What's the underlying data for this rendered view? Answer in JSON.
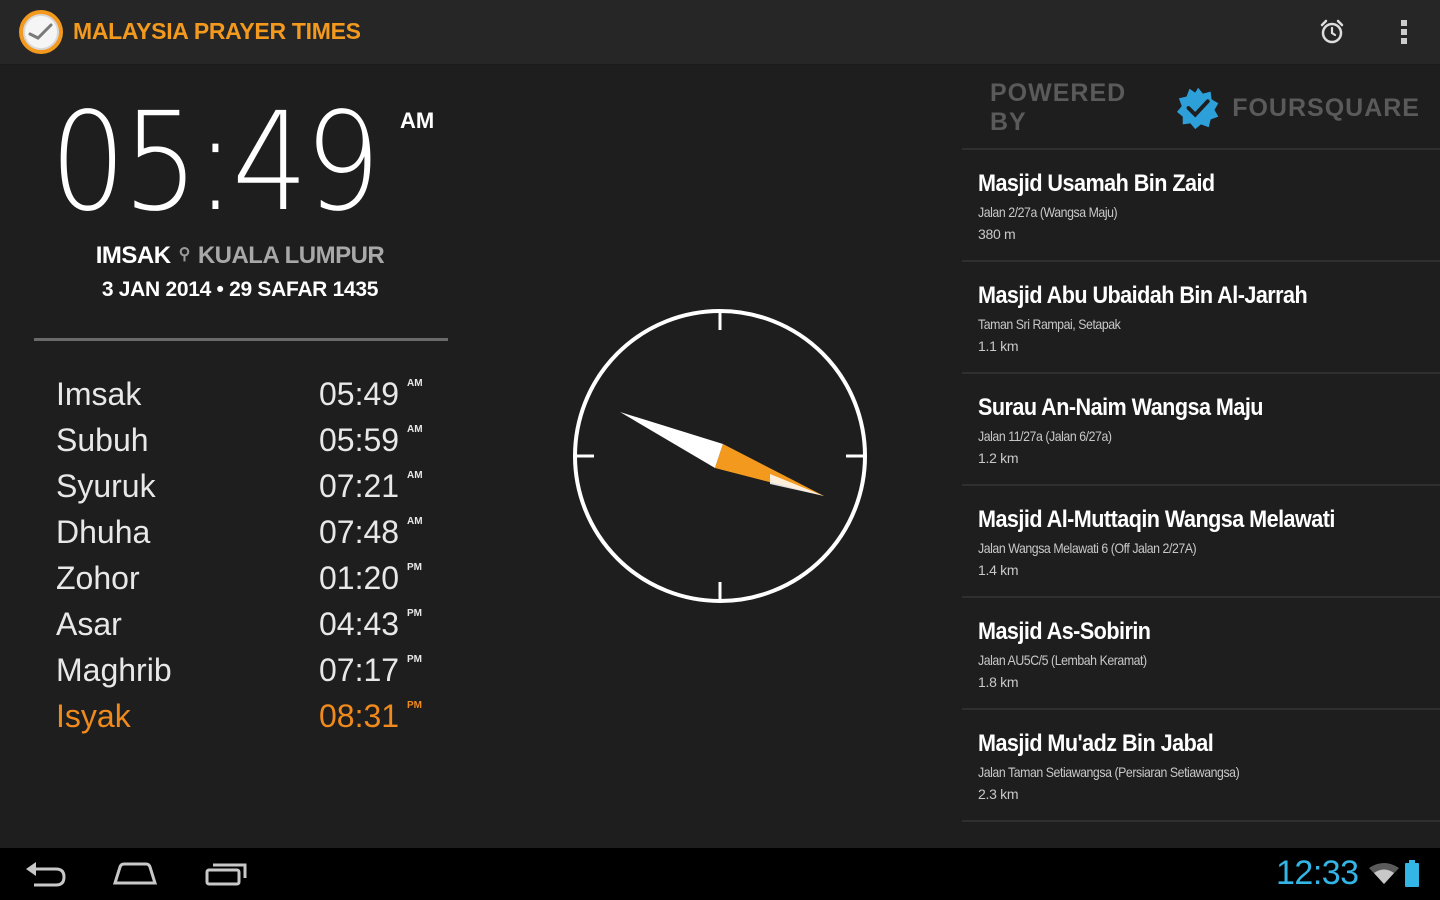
{
  "app": {
    "title": "MALAYSIA PRAYER TIMES",
    "accent_color": "#f39a1e",
    "actions": [
      "alarm-icon",
      "overflow-menu-icon"
    ]
  },
  "clock": {
    "time": "05:49",
    "ampm": "AM",
    "current_prayer": "IMSAK",
    "location": "KUALA LUMPUR",
    "date": "3 JAN 2014 • 29 SAFAR 1435"
  },
  "prayers": [
    {
      "name": "Imsak",
      "time": "05:49",
      "ampm": "AM"
    },
    {
      "name": "Subuh",
      "time": "05:59",
      "ampm": "AM"
    },
    {
      "name": "Syuruk",
      "time": "07:21",
      "ampm": "AM"
    },
    {
      "name": "Dhuha",
      "time": "07:48",
      "ampm": "AM"
    },
    {
      "name": "Zohor",
      "time": "01:20",
      "ampm": "PM"
    },
    {
      "name": "Asar",
      "time": "04:43",
      "ampm": "PM"
    },
    {
      "name": "Maghrib",
      "time": "07:17",
      "ampm": "PM"
    },
    {
      "name": "Isyak",
      "time": "08:31",
      "ampm": "PM"
    }
  ],
  "highlight_color": "#f08a1c",
  "compass": {
    "needle_colors": {
      "white": "#ffffff",
      "qibla": "#f39a1e"
    }
  },
  "powered_by": {
    "prefix": "POWERED BY",
    "brand": "FOURSQUARE",
    "brand_icon_color": "#2d9fd9"
  },
  "mosques": [
    {
      "name": "Masjid Usamah Bin Zaid",
      "address": "Jalan 2/27a (Wangsa Maju)",
      "distance": "380 m"
    },
    {
      "name": "Masjid Abu Ubaidah Bin Al-Jarrah",
      "address": "Taman Sri Rampai, Setapak",
      "distance": "1.1 km"
    },
    {
      "name": "Surau An-Naim Wangsa Maju",
      "address": "Jalan 11/27a (Jalan 6/27a)",
      "distance": "1.2 km"
    },
    {
      "name": "Masjid Al-Muttaqin Wangsa Melawati",
      "address": "Jalan Wangsa Melawati 6 (Off Jalan 2/27A)",
      "distance": "1.4 km"
    },
    {
      "name": "Masjid As-Sobirin",
      "address": "Jalan AU5C/5 (Lembah Keramat)",
      "distance": "1.8 km"
    },
    {
      "name": "Masjid Mu'adz Bin Jabal",
      "address": "Jalan Taman Setiawangsa (Persiaran Setiawangsa)",
      "distance": "2.3 km"
    }
  ],
  "system": {
    "clock": "12:33",
    "clock_color": "#33b5e5"
  }
}
